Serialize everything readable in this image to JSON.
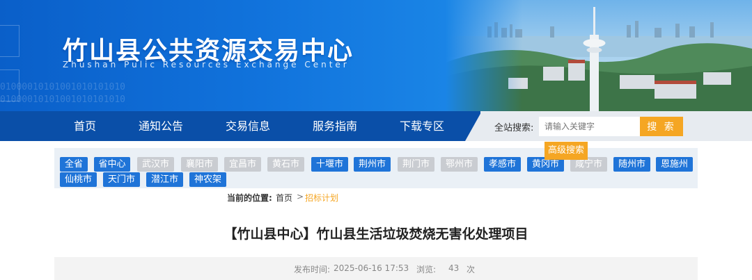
{
  "banner": {
    "title": "竹山县公共资源交易中心",
    "subtitle": "Zhushan Pulic Resources Exchange Center",
    "binary_text": "01000010101001010101010"
  },
  "nav": {
    "items": [
      "首页",
      "通知公告",
      "交易信息",
      "服务指南",
      "下载专区"
    ]
  },
  "search": {
    "label": "全站搜索:",
    "placeholder": "请输入关键字",
    "button": "搜 索",
    "advanced": "高级搜索"
  },
  "regions": {
    "items": [
      {
        "label": "全省",
        "active": true
      },
      {
        "label": "省中心",
        "active": true
      },
      {
        "label": "武汉市",
        "active": false
      },
      {
        "label": "襄阳市",
        "active": false
      },
      {
        "label": "宜昌市",
        "active": false
      },
      {
        "label": "黄石市",
        "active": false
      },
      {
        "label": "十堰市",
        "active": true
      },
      {
        "label": "荆州市",
        "active": true
      },
      {
        "label": "荆门市",
        "active": false
      },
      {
        "label": "鄂州市",
        "active": false
      },
      {
        "label": "孝感市",
        "active": true
      },
      {
        "label": "黄冈市",
        "active": true
      },
      {
        "label": "咸宁市",
        "active": false
      },
      {
        "label": "随州市",
        "active": true
      },
      {
        "label": "恩施州",
        "active": true
      },
      {
        "label": "仙桃市",
        "active": true
      },
      {
        "label": "天门市",
        "active": true
      },
      {
        "label": "潜江市",
        "active": true
      },
      {
        "label": "神农架",
        "active": true
      }
    ]
  },
  "breadcrumb": {
    "label": "当前的位置:",
    "home": "首页",
    "separator": ">",
    "current": "招标计划"
  },
  "article": {
    "title": "【竹山县中心】竹山县生活垃圾焚烧无害化处理项目",
    "publish_label": "发布时间:",
    "publish_time": "2025-06-16 17:53",
    "views_label": "浏览:",
    "views": "43",
    "views_unit": "次"
  },
  "colors": {
    "nav_bg": "#0a4fa8",
    "accent": "#f5a623",
    "tag_active": "#1f74d8",
    "tag_inactive": "#c9ccd1",
    "current_crumb": "#f5a623"
  }
}
